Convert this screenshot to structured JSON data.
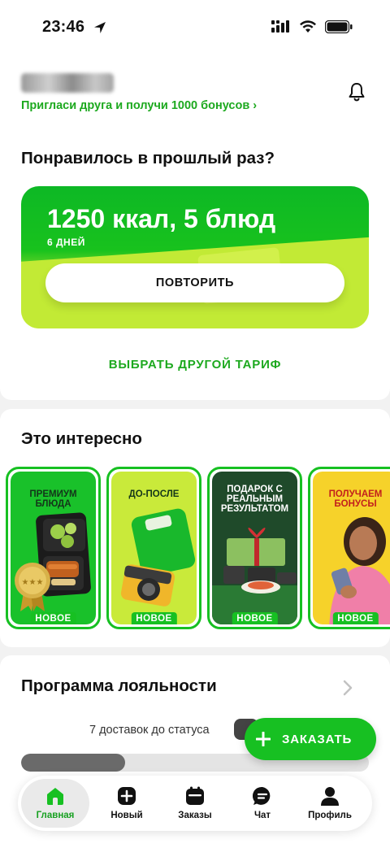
{
  "status_bar": {
    "time": "23:46"
  },
  "header": {
    "invite_text": "Пригласи друга и получи 1000 бонусов ›"
  },
  "repeat_section": {
    "title": "Понравилось в прошлый раз?",
    "promo_title": "1250 ккал, 5 блюд",
    "promo_subtitle": "6 ДНЕЙ",
    "repeat_button": "ПОВТОРИТЬ",
    "choose_other": "ВЫБРАТЬ ДРУГОЙ ТАРИФ"
  },
  "interesting": {
    "title": "Это интересно",
    "stories": [
      {
        "title": "ПРЕМИУМ БЛЮДА",
        "badge": "НОВОЕ"
      },
      {
        "title": "ДО-ПОСЛЕ",
        "badge": "НОВОЕ"
      },
      {
        "title": "ПОДАРОК С РЕАЛЬНЫМ РЕЗУЛЬТАТОМ",
        "badge": "НОВОЕ"
      },
      {
        "title": "ПОЛУЧАЕМ БОНУСЫ",
        "badge": "НОВОЕ"
      }
    ]
  },
  "loyalty": {
    "title": "Программа лояльности",
    "progress_text": "7 доставок до статуса",
    "progress_fraction": 0.3
  },
  "order_button": "ЗАКАЗАТЬ",
  "tabbar": {
    "items": [
      {
        "label": "Главная",
        "icon": "home-icon",
        "active": true
      },
      {
        "label": "Новый",
        "icon": "plus-icon"
      },
      {
        "label": "Заказы",
        "icon": "calendar-icon"
      },
      {
        "label": "Чат",
        "icon": "chat-icon"
      },
      {
        "label": "Профиль",
        "icon": "profile-icon"
      }
    ]
  },
  "colors": {
    "accent": "#17c022",
    "accent_text": "#1da91f",
    "lime": "#c6ec3a"
  }
}
